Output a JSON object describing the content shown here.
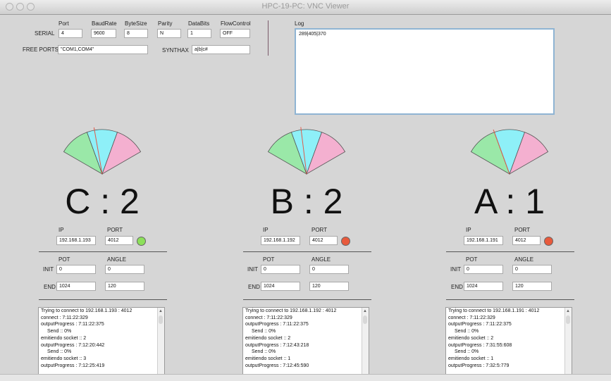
{
  "window": {
    "title": "HPC-19-PC: VNC Viewer"
  },
  "serial": {
    "row_label": "SERIAL",
    "headers": [
      "Port",
      "BaudRate",
      "ByteSize",
      "Parity",
      "DataBits",
      "FlowControl"
    ],
    "values": [
      "4",
      "9600",
      "8",
      "N",
      "1",
      "OFF"
    ],
    "free_ports_label": "FREE PORTS",
    "free_ports_value": "\"COM1,COM4\"",
    "synthax_label": "SYNTHAX",
    "synthax_value": "a|b|c#"
  },
  "log": {
    "label": "Log",
    "value": "289|405|370"
  },
  "panels": [
    {
      "name": "C",
      "big_label": "C : 2",
      "ip_label": "IP",
      "port_label": "PORT",
      "ip": "192.168.1.193",
      "port": "4012",
      "status_color": "#8ce05a",
      "pot_label": "POT",
      "angle_label": "ANGLE",
      "init_label": "INIT",
      "end_label": "END",
      "init_pot": "0",
      "init_angle": "0",
      "end_pot": "1024",
      "end_angle": "120",
      "log_lines": [
        "Trying to connect to 192.168.1.193 : 4012",
        "connect : 7:11:22:329",
        "outputProgress : 7:11:22:375",
        "Send :: 0%",
        "emitiendo socket :: 2",
        "outputProgress : 7:12:20:442",
        "Send :: 0%",
        "emitiendo socket :: 3",
        "outputProgress : 7:12:25:419"
      ],
      "needle_angle": -10
    },
    {
      "name": "B",
      "big_label": "B : 2",
      "ip_label": "IP",
      "port_label": "PORT",
      "ip": "192.168.1.192",
      "port": "4012",
      "status_color": "#e85a3c",
      "pot_label": "POT",
      "angle_label": "ANGLE",
      "init_label": "INIT",
      "end_label": "END",
      "init_pot": "0",
      "init_angle": "0",
      "end_pot": "1024",
      "end_angle": "120",
      "log_lines": [
        "Trying to connect to 192.168.1.192 : 4012",
        "connect : 7:11:22:329",
        "outputProgress : 7:11:22:375",
        "Send :: 0%",
        "emitiendo socket :: 2",
        "outputProgress : 7:12:43:218",
        "Send :: 0%",
        "emitiendo socket :: 1",
        "outputProgress : 7:12:45:590"
      ],
      "needle_angle": -7
    },
    {
      "name": "A",
      "big_label": "A : 1",
      "ip_label": "IP",
      "port_label": "PORT",
      "ip": "192.168.1.191",
      "port": "4012",
      "status_color": "#e85a3c",
      "pot_label": "POT",
      "angle_label": "ANGLE",
      "init_label": "INIT",
      "end_label": "END",
      "init_pot": "0",
      "init_angle": "0",
      "end_pot": "1024",
      "end_angle": "120",
      "log_lines": [
        "Trying to connect to 192.168.1.191 : 4012",
        "connect : 7:11:22:329",
        "outputProgress : 7:11:22:375",
        "Send :: 0%",
        "emitiendo socket :: 2",
        "outputProgress : 7:31:55:608",
        "Send :: 0%",
        "emitiendo socket :: 1",
        "outputProgress : 7:32:5:779"
      ],
      "needle_angle": -20
    }
  ],
  "colors": {
    "sector_left": "#9ae8a8",
    "sector_mid": "#8ef0f8",
    "sector_right": "#f4b0d0",
    "needle": "#e05a4a"
  }
}
